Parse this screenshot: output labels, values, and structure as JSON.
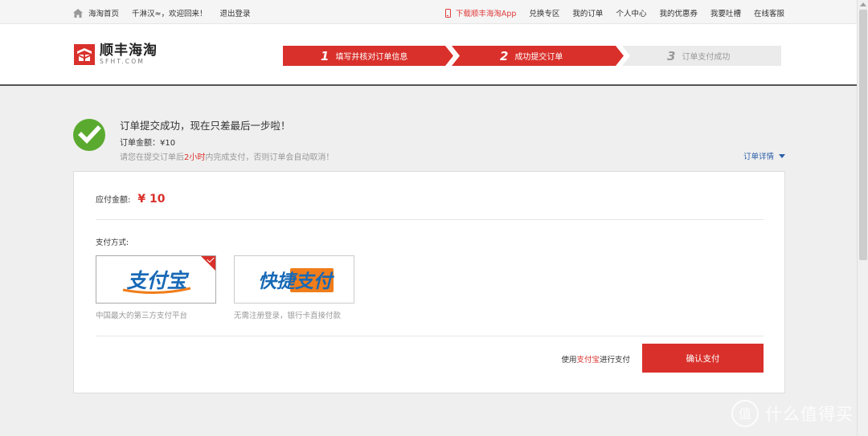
{
  "topbar": {
    "home": "海淘首页",
    "welcome": "千淋汉≈，欢迎回来！",
    "logout": "退出登录",
    "app": "下载顺丰海淘App",
    "links": [
      "兑换专区",
      "我的订单",
      "个人中心",
      "我的优惠券",
      "我要吐槽",
      "在线客服"
    ]
  },
  "logo": {
    "cn": "顺丰海淘",
    "en": "SFHT.COM"
  },
  "steps": [
    {
      "num": "1",
      "label": "填写并核对订单信息",
      "state": "done"
    },
    {
      "num": "2",
      "label": "成功提交订单",
      "state": "current"
    },
    {
      "num": "3",
      "label": "订单支付成功",
      "state": "todo"
    }
  ],
  "success": {
    "title": "订单提交成功，现在只差最后一步啦！",
    "amount": "订单金额：¥10",
    "hint_pre": "请您在提交订单后",
    "hint_time": "2小时",
    "hint_post": "内完成支付，否则订单会自动取消！",
    "detail_link": "订单详情"
  },
  "payment": {
    "amount_label": "应付金额:",
    "amount_value": "¥ 10",
    "method_label": "支付方式:",
    "methods": [
      {
        "name": "支付宝",
        "desc": "中国最大的第三方支付平台",
        "selected": true
      },
      {
        "name": "快捷支付",
        "desc": "无需注册登录，银行卡直接付款",
        "selected": false
      }
    ],
    "confirm_pre": "使用",
    "confirm_method": "支付宝",
    "confirm_post": "进行支付",
    "confirm_button": "确认支付"
  },
  "watermark": "什么值得买",
  "colors": {
    "brand_red": "#d9302b",
    "success_green": "#5aaa2f",
    "link_blue": "#2a5fa8"
  },
  "icons": {
    "home": "home-icon",
    "phone": "phone-icon",
    "check": "check-circle-icon",
    "dropdown": "triangle-down-icon"
  }
}
